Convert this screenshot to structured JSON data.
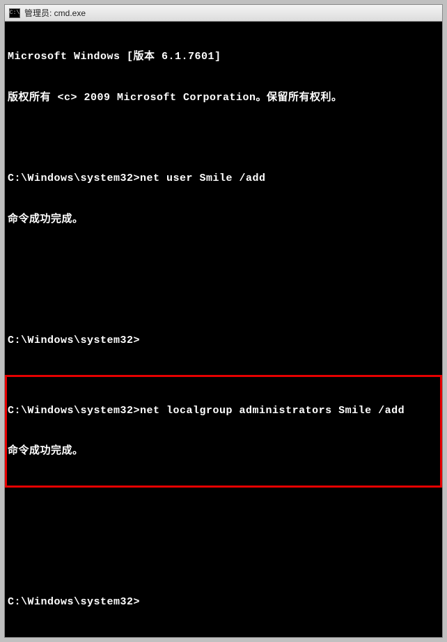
{
  "titlebar": {
    "icon_label": "C:\\",
    "title": "管理员: cmd.exe"
  },
  "terminal": {
    "lines": {
      "version": "Microsoft Windows [版本 6.1.7601]",
      "copyright": "版权所有 <c> 2009 Microsoft Corporation。保留所有权利。",
      "prompt1_path": "C:\\Windows\\system32>",
      "prompt1_cmd": "net user Smile /add",
      "result1": "命令成功完成。",
      "prompt2_path": "C:\\Windows\\system32>",
      "prompt3_path": "C:\\Windows\\system32>",
      "prompt3_cmd": "net localgroup administrators Smile /add",
      "result3": "命令成功完成。",
      "prompt4_path": "C:\\Windows\\system32>"
    }
  }
}
